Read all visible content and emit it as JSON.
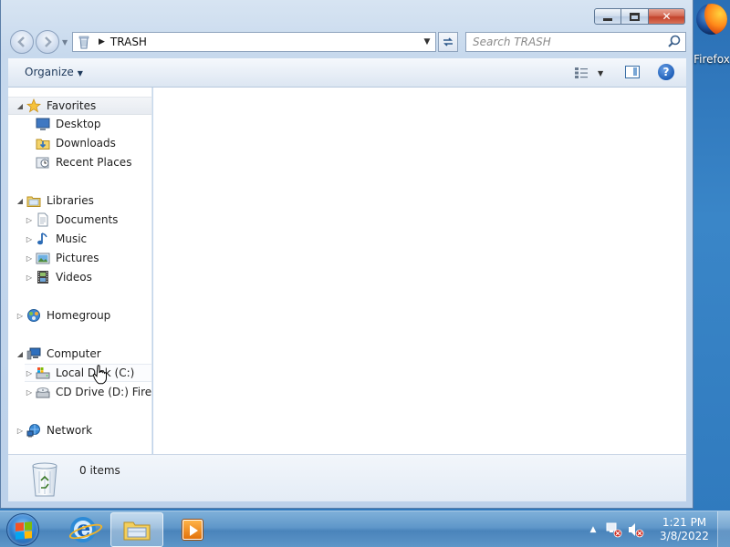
{
  "desktop": {
    "icons": [
      {
        "label": "Firefox",
        "icon": "firefox-icon"
      }
    ]
  },
  "window": {
    "caption_buttons": {
      "minimize": "minimize",
      "maximize": "maximize",
      "close": "✕"
    },
    "address": {
      "crumb": "TRASH",
      "icon": "recycle-bin-icon"
    },
    "search": {
      "placeholder": "Search TRASH"
    },
    "command_bar": {
      "organize_label": "Organize"
    },
    "nav_pane": {
      "favorites": {
        "label": "Favorites",
        "items": [
          "Desktop",
          "Downloads",
          "Recent Places"
        ]
      },
      "libraries": {
        "label": "Libraries",
        "items": [
          "Documents",
          "Music",
          "Pictures",
          "Videos"
        ]
      },
      "homegroup": {
        "label": "Homegroup"
      },
      "computer": {
        "label": "Computer",
        "items": [
          "Local Disk (C:)",
          "CD Drive (D:) Firefox"
        ]
      },
      "network": {
        "label": "Network"
      }
    },
    "details_pane": {
      "items_count": "0 items"
    }
  },
  "taskbar": {
    "apps": [
      "start-button",
      "internet-explorer-icon",
      "windows-explorer-icon",
      "windows-media-player-icon"
    ],
    "clock": {
      "time": "1:21 PM",
      "date": "3/8/2022"
    }
  }
}
